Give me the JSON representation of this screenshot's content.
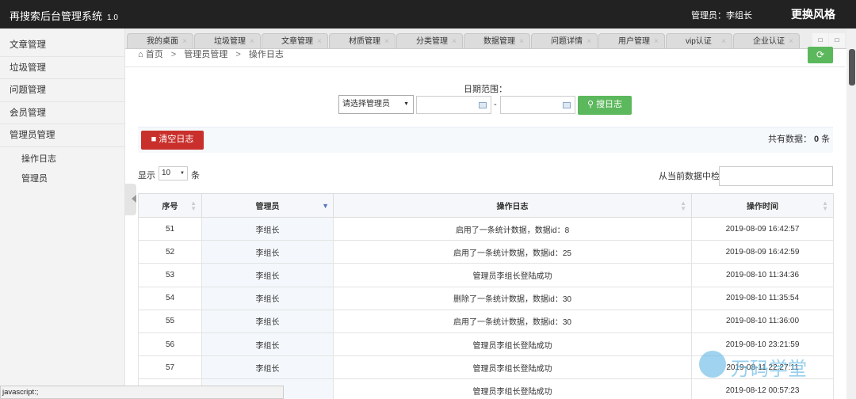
{
  "header": {
    "app_title": "再搜索后台管理系统",
    "version": "1.0",
    "admin_label": "管理员：李组长",
    "switch_style": "更换风格"
  },
  "sidebar": {
    "items": [
      {
        "label": "文章管理"
      },
      {
        "label": "垃圾管理"
      },
      {
        "label": "问题管理"
      },
      {
        "label": "会员管理"
      },
      {
        "label": "管理员管理"
      }
    ],
    "subitems": [
      {
        "label": "操作日志"
      },
      {
        "label": "管理员"
      }
    ]
  },
  "tabs": [
    {
      "label": "我的桌面"
    },
    {
      "label": "垃圾管理"
    },
    {
      "label": "文章管理"
    },
    {
      "label": "材质管理"
    },
    {
      "label": "分类管理"
    },
    {
      "label": "数据管理"
    },
    {
      "label": "问题详情"
    },
    {
      "label": "用户管理"
    },
    {
      "label": "vip认证"
    },
    {
      "label": "企业认证"
    }
  ],
  "tab_close": "×",
  "breadcrumb": {
    "home_icon": "home-icon",
    "home": "首页",
    "sep": ">",
    "level1": "管理员管理",
    "level2": "操作日志"
  },
  "search": {
    "date_range_label": "日期范围：",
    "admin_select": "请选择管理员",
    "dash": "-",
    "button": "搜日志",
    "button_icon": "search-icon"
  },
  "actions": {
    "clear_button": "清空日志",
    "clear_icon": "trash-icon",
    "total_prefix": "共有数据：",
    "total_count": "0",
    "total_suffix": "条"
  },
  "table_controls": {
    "show_label": "显示",
    "page_length": "10",
    "unit": "条",
    "filter_label": "从当前数据中检索:"
  },
  "table": {
    "columns": [
      "序号",
      "管理员",
      "操作日志",
      "操作时间"
    ],
    "rows": [
      {
        "id": "51",
        "admin": "李组长",
        "log": "启用了一条统计数据，数据id：8",
        "time": "2019-08-09 16:42:57"
      },
      {
        "id": "52",
        "admin": "李组长",
        "log": "启用了一条统计数据，数据id：25",
        "time": "2019-08-09 16:42:59"
      },
      {
        "id": "53",
        "admin": "李组长",
        "log": "管理员李组长登陆成功",
        "time": "2019-08-10 11:34:36"
      },
      {
        "id": "54",
        "admin": "李组长",
        "log": "删除了一条统计数据，数据id：30",
        "time": "2019-08-10 11:35:54"
      },
      {
        "id": "55",
        "admin": "李组长",
        "log": "启用了一条统计数据，数据id：30",
        "time": "2019-08-10 11:36:00"
      },
      {
        "id": "56",
        "admin": "李组长",
        "log": "管理员李组长登陆成功",
        "time": "2019-08-10 23:21:59"
      },
      {
        "id": "57",
        "admin": "李组长",
        "log": "管理员李组长登陆成功",
        "time": "2019-08-11 22:27:11"
      },
      {
        "id": "",
        "admin": "",
        "log": "管理员李组长登陆成功",
        "time": "2019-08-12 00:57:23"
      }
    ]
  },
  "watermark": "万码学堂",
  "status_url": "javascript:;",
  "colors": {
    "topbar": "#222222",
    "green": "#5cb85c",
    "red": "#c9302c"
  }
}
